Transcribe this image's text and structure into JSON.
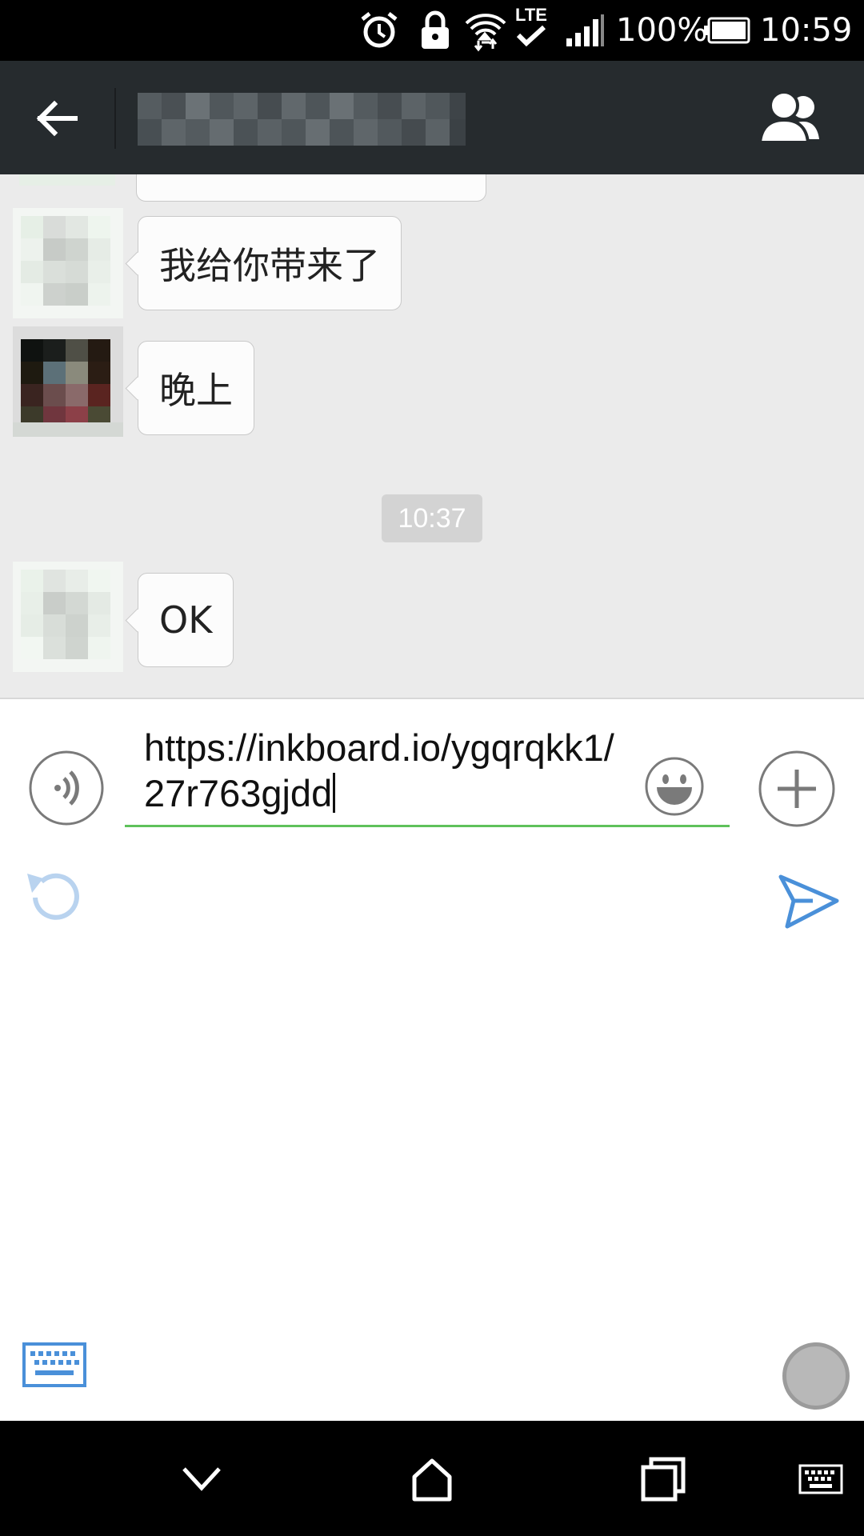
{
  "status_bar": {
    "battery": "100%",
    "time": "10:59",
    "network": "LTE",
    "icons": [
      "alarm-icon",
      "lock-icon",
      "wifi-icon",
      "lte-icon",
      "signal-icon",
      "battery-icon"
    ]
  },
  "header": {
    "title": "",
    "icons": [
      "back-arrow-icon",
      "group-members-icon"
    ]
  },
  "messages": [
    {
      "text": "我给你带来了"
    },
    {
      "text": "晚上"
    },
    {
      "timestamp": "10:37"
    },
    {
      "text": "OK"
    }
  ],
  "input": {
    "value": "https://inkboard.io/ygqrqkk1/27r763gjdd"
  },
  "toolbar_icons": [
    "voice-icon",
    "emoji-icon",
    "plus-icon",
    "undo-icon",
    "send-icon",
    "keyboard-icon"
  ],
  "nav_bar": {
    "icons": [
      "hide-keyboard-icon",
      "home-icon",
      "recents-icon",
      "keyboard-switch-icon"
    ]
  },
  "colors": {
    "header_bg": "#262b2e",
    "chat_bg": "#ebebeb",
    "input_underline": "#5fc15b",
    "accent_blue": "#4a90d9",
    "time_chip_bg": "#d3d3d3"
  }
}
